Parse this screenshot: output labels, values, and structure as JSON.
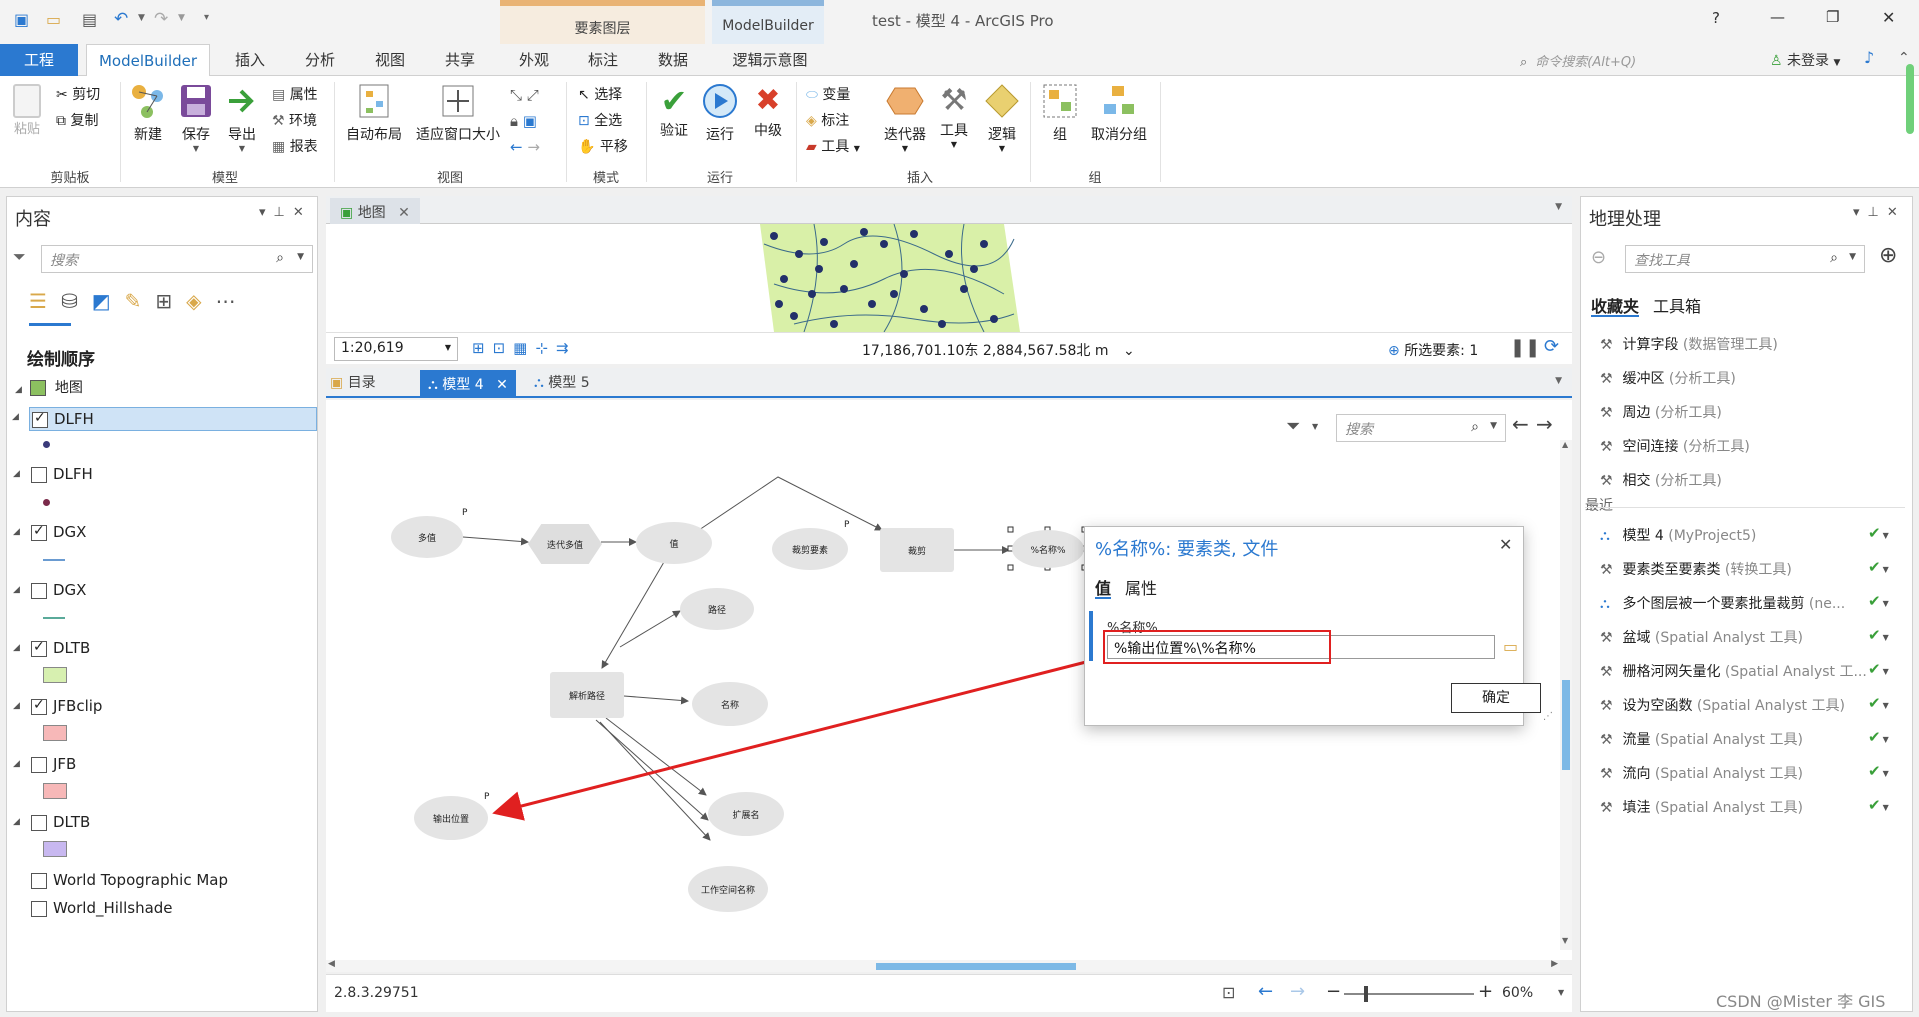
{
  "window": {
    "title": "test - 模型 4 - ArcGIS Pro",
    "help": "?",
    "minimize": "—",
    "restore": "❐",
    "close": "✕",
    "context_tabs": [
      "要素图层",
      "ModelBuilder"
    ]
  },
  "tabs": {
    "items": [
      "工程",
      "ModelBuilder",
      "插入",
      "分析",
      "视图",
      "共享",
      "外观",
      "标注",
      "数据",
      "逻辑示意图"
    ],
    "active": "ModelBuilder",
    "command_search_placeholder": "命令搜索(Alt+Q)",
    "login": "未登录"
  },
  "ribbon": {
    "clipboard": {
      "paste": "粘贴",
      "cut": "剪切",
      "copy": "复制",
      "label": "剪贴板"
    },
    "model": {
      "new": "新建",
      "save": "保存",
      "export": "导出",
      "properties": "属性",
      "environments": "环境",
      "report": "报表",
      "label": "模型"
    },
    "view": {
      "auto_layout": "自动布局",
      "fit_window": "适应窗口大小",
      "label": "视图"
    },
    "mode": {
      "select": "选择",
      "select_all": "全选",
      "pan": "平移",
      "label": "模式"
    },
    "run": {
      "validate": "验证",
      "run": "运行",
      "stop": "中级",
      "label": "运行"
    },
    "insert": {
      "variable": "变量",
      "label_tool": "标注",
      "tools": "工具",
      "iterators": "迭代器",
      "tool": "工具",
      "logic": "逻辑",
      "label": "插入"
    },
    "group": {
      "group": "组",
      "ungroup": "取消分组",
      "label": "组"
    }
  },
  "contents": {
    "title": "内容",
    "search_placeholder": "搜索",
    "drawing_order": "绘制顺序",
    "map": "地图",
    "layers": [
      {
        "name": "DLFH",
        "checked": true,
        "selected": true,
        "symbol": "dot",
        "color": "#3a3a7a"
      },
      {
        "name": "DLFH",
        "checked": false,
        "selected": false,
        "symbol": "dot",
        "color": "#7a2a4a"
      },
      {
        "name": "DGX",
        "checked": true,
        "selected": false,
        "symbol": "line",
        "color": "#6a9bd1"
      },
      {
        "name": "DGX",
        "checked": false,
        "selected": false,
        "symbol": "line",
        "color": "#5aaa9a"
      },
      {
        "name": "DLTB",
        "checked": true,
        "selected": false,
        "symbol": "fill",
        "color": "#d7f0b0"
      },
      {
        "name": "JFBclip",
        "checked": true,
        "selected": false,
        "symbol": "fill",
        "color": "#f7b8b8"
      },
      {
        "name": "JFB",
        "checked": false,
        "selected": false,
        "symbol": "fill",
        "color": "#f7b8b8"
      },
      {
        "name": "DLTB",
        "checked": false,
        "selected": false,
        "symbol": "fill",
        "color": "#c8b8f0"
      }
    ],
    "basemaps": [
      "World Topographic Map",
      "World_Hillshade"
    ]
  },
  "map_view": {
    "tab": "地图",
    "scale": "1:20,619",
    "coordinates": "17,186,701.10东 2,884,567.58北 m",
    "selected_features": "所选要素: 1"
  },
  "model_view": {
    "tabs": [
      "目录",
      "模型 4",
      "模型 5"
    ],
    "active_tab": "模型 4",
    "search_placeholder": "搜索",
    "version": "2.8.3.29751",
    "zoom": "60%",
    "nodes": {
      "multi_value": "多值",
      "iterate": "迭代多值",
      "value": "值",
      "clip_feature": "裁剪要素",
      "clip": "裁剪",
      "name_var": "%名称%",
      "path": "路径",
      "parse_path": "解析路径",
      "name": "名称",
      "output_location": "输出位置",
      "extension": "扩展名",
      "workspace_name": "工作空间名称",
      "p": "P"
    }
  },
  "dialog": {
    "title": "%名称%: 要素类, 文件",
    "tabs": [
      "值",
      "属性"
    ],
    "field_label": "%名称%",
    "value": "%输出位置%\\%名称%",
    "ok": "确定"
  },
  "geoprocessing": {
    "title": "地理处理",
    "search_placeholder": "查找工具",
    "tabs": [
      "收藏夹",
      "工具箱"
    ],
    "favorites": [
      {
        "name": "计算字段",
        "sub": "(数据管理工具)"
      },
      {
        "name": "缓冲区",
        "sub": "(分析工具)"
      },
      {
        "name": "周边",
        "sub": "(分析工具)"
      },
      {
        "name": "空间连接",
        "sub": "(分析工具)"
      },
      {
        "name": "相交",
        "sub": "(分析工具)"
      }
    ],
    "recent_label": "最近",
    "recent": [
      {
        "name": "模型 4",
        "sub": "(MyProject5)",
        "kind": "model"
      },
      {
        "name": "要素类至要素类",
        "sub": "(转换工具)",
        "kind": "tool"
      },
      {
        "name": "多个图层被一个要素批量裁剪",
        "sub": "(ne...",
        "kind": "model"
      },
      {
        "name": "盆域",
        "sub": "(Spatial Analyst 工具)",
        "kind": "tool"
      },
      {
        "name": "栅格河网矢量化",
        "sub": "(Spatial Analyst 工...",
        "kind": "tool"
      },
      {
        "name": "设为空函数",
        "sub": "(Spatial Analyst 工具)",
        "kind": "tool"
      },
      {
        "name": "流量",
        "sub": "(Spatial Analyst 工具)",
        "kind": "tool"
      },
      {
        "name": "流向",
        "sub": "(Spatial Analyst 工具)",
        "kind": "tool"
      },
      {
        "name": "填洼",
        "sub": "(Spatial Analyst 工具)",
        "kind": "tool"
      }
    ]
  },
  "watermark": "CSDN @Mister 李 GIS",
  "colors": {
    "accent": "#2b79d0",
    "red": "#e02020",
    "green": "#3aa03a"
  }
}
